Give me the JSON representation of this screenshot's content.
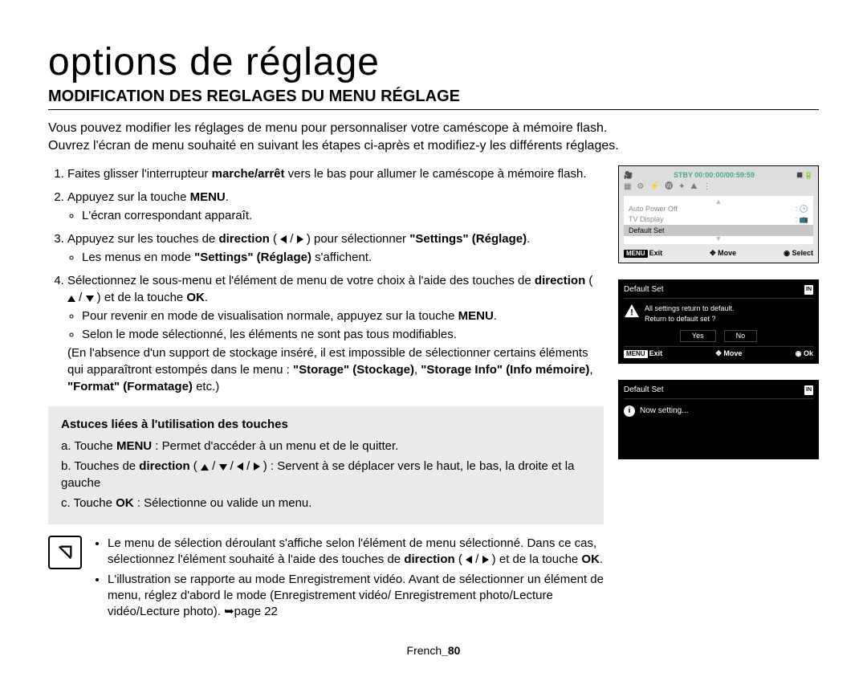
{
  "doc_title": "options de réglage",
  "section_title": "MODIFICATION DES REGLAGES DU MENU RÉGLAGE",
  "intro_line1": "Vous pouvez modifier les réglages de menu pour personnaliser votre caméscope à mémoire flash.",
  "intro_line2": "Ouvrez l'écran de menu souhaité en suivant les étapes ci-après et modifiez-y les différents réglages.",
  "steps": {
    "s1_a": "Faites glisser l'interrupteur ",
    "s1_b": "marche/arrêt",
    "s1_c": " vers le bas pour allumer le caméscope à mémoire flash.",
    "s2_a": "Appuyez sur la touche ",
    "s2_b": "MENU",
    "s2_c": ".",
    "s2_bullet": "L'écran correspondant apparaît.",
    "s3_a": "Appuyez sur les touches de ",
    "s3_b": "direction",
    "s3_c": " ( ",
    "s3_d": " / ",
    "s3_e": " ) pour sélectionner ",
    "s3_f": "\"Settings\" (Réglage)",
    "s3_g": ".",
    "s3_bullet_a": "Les menus en mode ",
    "s3_bullet_b": "\"Settings\" (Réglage)",
    "s3_bullet_c": " s'affichent.",
    "s4_a": "Sélectionnez le sous-menu et l'élément de menu de votre choix à l'aide des touches de ",
    "s4_b": "direction",
    "s4_c": " ( ",
    "s4_d": " / ",
    "s4_e": " ) et de la touche ",
    "s4_f": "OK",
    "s4_g": ".",
    "s4_bullet1_a": "Pour revenir en mode de visualisation normale, appuyez sur la touche ",
    "s4_bullet1_b": "MENU",
    "s4_bullet1_c": ".",
    "s4_bullet2": "Selon le mode sélectionné, les éléments ne sont pas tous modifiables.",
    "s4_bullet3_a": "(En l'absence d'un support de stockage inséré, il est impossible de sélectionner certains éléments qui apparaîtront estompés dans le menu : ",
    "s4_bullet3_b": "\"Storage\" (Stockage)",
    "s4_bullet3_c": ", ",
    "s4_bullet3_d": "\"Storage Info\" (Info mémoire)",
    "s4_bullet3_e": ", ",
    "s4_bullet3_f": "\"Format\" (Formatage)",
    "s4_bullet3_g": " etc.)"
  },
  "tips": {
    "title": "Astuces liées à l'utilisation des touches",
    "a_pre": "a.   Touche ",
    "a_bold": "MENU",
    "a_post": " : Permet d'accéder à un menu et de le quitter.",
    "b_pre": "b.   Touches de ",
    "b_bold": "direction",
    "b_mid": " ( ",
    "b_sep": " / ",
    "b_post": " ) : Servent à se déplacer vers le haut, le bas, la droite et la gauche",
    "c_pre": "c.   Touche ",
    "c_bold": "OK",
    "c_post": " : Sélectionne ou valide un menu."
  },
  "notes": {
    "n1_a": "Le menu de sélection déroulant s'affiche selon l'élément de menu sélectionné. Dans ce cas, sélectionnez l'élément souhaité à l'aide des touches de ",
    "n1_b": "direction",
    "n1_c": " ( ",
    "n1_d": " / ",
    "n1_e": " ) et de la touche ",
    "n1_f": "OK",
    "n1_g": ".",
    "n2": "L'illustration se rapporte au mode Enregistrement vidéo. Avant de sélectionner un élément de menu, réglez d'abord le mode (Enregistrement vidéo/ Enregistrement photo/Lecture vidéo/Lecture photo). ➥page 22"
  },
  "footer": {
    "lang": "French",
    "page": "_80"
  },
  "screen1": {
    "stby": "STBY",
    "time": "00:00:00/00:59:59",
    "menu_item1": "Auto Power Off",
    "menu_item2": "TV Display",
    "menu_item3": "Default Set",
    "foot_menu": "MENU",
    "foot_exit": "Exit",
    "foot_move": "Move",
    "foot_select": "Select"
  },
  "screen2": {
    "title": "Default Set",
    "line1": "All settings return to default.",
    "line2": "Return to default set ?",
    "yes": "Yes",
    "no": "No",
    "foot_menu": "MENU",
    "foot_exit": "Exit",
    "foot_move": "Move",
    "foot_ok": "Ok"
  },
  "screen3": {
    "title": "Default Set",
    "body": "Now setting..."
  }
}
